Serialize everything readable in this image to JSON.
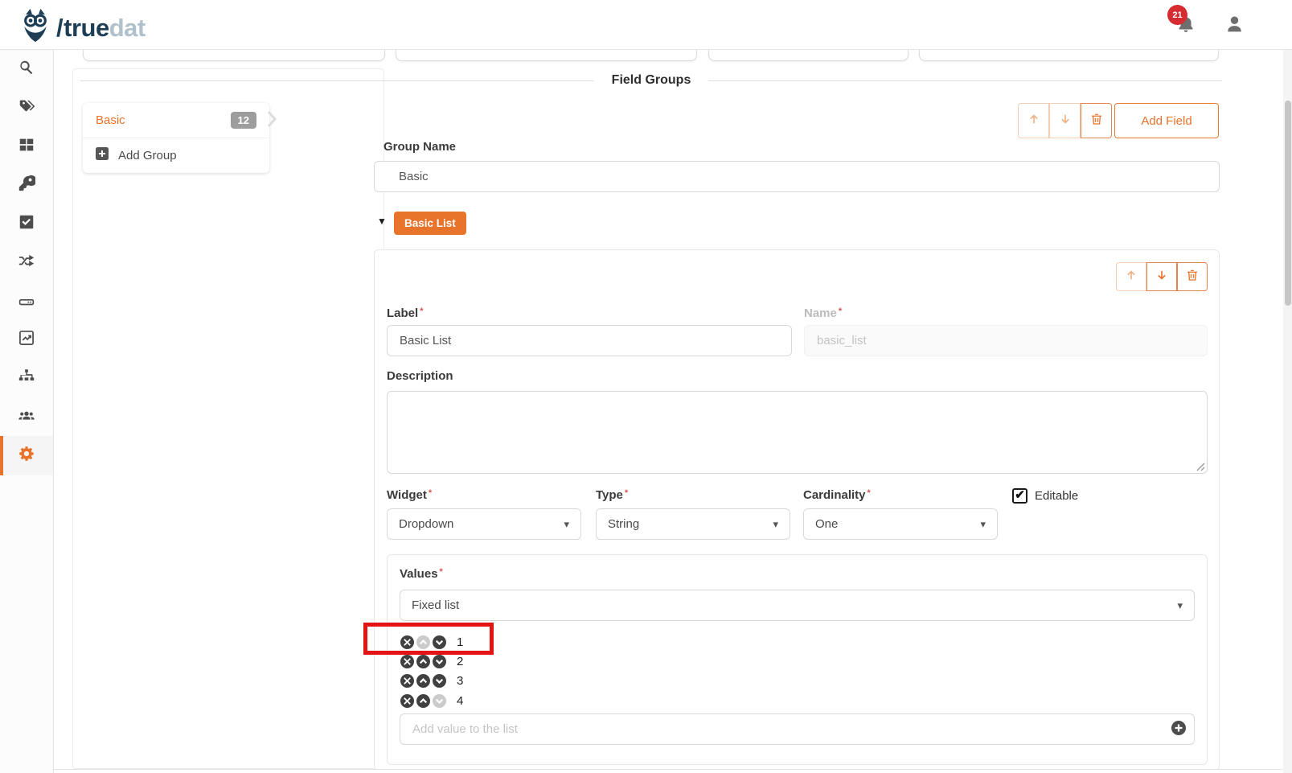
{
  "header": {
    "logo": {
      "slash": "/",
      "part_primary": "true",
      "part_secondary": "dat"
    },
    "notification_count": "21"
  },
  "sidebar": {
    "icons": [
      "search",
      "tags",
      "grid",
      "key",
      "check-square",
      "shuffle",
      "storage",
      "chart-line",
      "sitemap",
      "users",
      "settings"
    ],
    "active_icon": "settings"
  },
  "main": {
    "section_title": "Field Groups",
    "groups_panel": {
      "group_label": "Basic",
      "group_count": "12",
      "add_group_label": "Add Group"
    },
    "toolbar": {
      "add_field_label": "Add Field"
    },
    "form": {
      "group_name_label": "Group Name",
      "group_name_value": "Basic",
      "collapsible_label": "Basic List",
      "field": {
        "label_label": "Label",
        "label_value": "Basic List",
        "name_label": "Name",
        "name_placeholder": "basic_list",
        "description_label": "Description",
        "description_value": "",
        "widget_label": "Widget",
        "widget_value": "Dropdown",
        "type_label": "Type",
        "type_value": "String",
        "cardinality_label": "Cardinality",
        "cardinality_value": "One",
        "editable_label": "Editable",
        "editable_checked": true,
        "values_label": "Values",
        "values_source_value": "Fixed list",
        "values_list": [
          {
            "value": "1",
            "up_disabled": true,
            "down_disabled": false,
            "highlighted": true
          },
          {
            "value": "2",
            "up_disabled": false,
            "down_disabled": false,
            "highlighted": false
          },
          {
            "value": "3",
            "up_disabled": false,
            "down_disabled": false,
            "highlighted": false
          },
          {
            "value": "4",
            "up_disabled": false,
            "down_disabled": true,
            "highlighted": false
          }
        ],
        "add_value_placeholder": "Add value to the list"
      }
    }
  },
  "colors": {
    "accent": "#e8732a",
    "logo_primary": "#1d3e55",
    "logo_secondary": "#b0c1cc",
    "notification_badge": "#d62b31",
    "annotation_red": "#e41414",
    "list_icon_dark": "#404040",
    "list_icon_disabled": "#cbcbcb"
  }
}
